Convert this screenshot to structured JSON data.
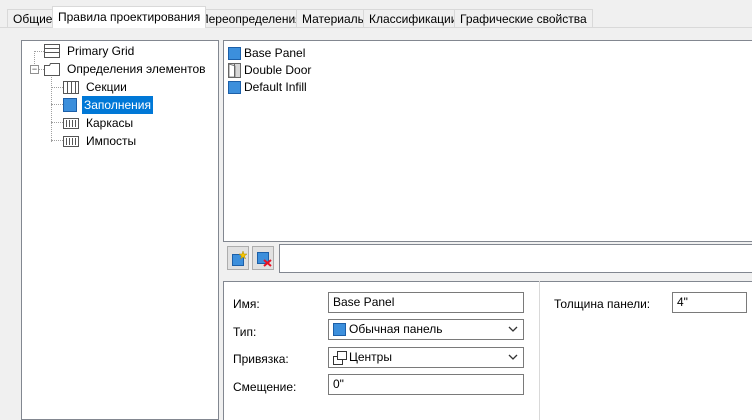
{
  "tabs": [
    {
      "label": "Общие",
      "active": false
    },
    {
      "label": "Правила проектирования",
      "active": true
    },
    {
      "label": "Переопределения",
      "active": false
    },
    {
      "label": "Материалы",
      "active": false
    },
    {
      "label": "Классификации",
      "active": false
    },
    {
      "label": "Графические свойства",
      "active": false
    }
  ],
  "tree": {
    "primary_grid": "Primary Grid",
    "element_definitions": "Определения элементов",
    "children": [
      "Секции",
      "Заполнения",
      "Каркасы",
      "Импосты"
    ],
    "selected": "Заполнения"
  },
  "list": {
    "items": [
      {
        "label": "Base Panel",
        "icon": "panel-icon"
      },
      {
        "label": "Double Door",
        "icon": "door-icon"
      },
      {
        "label": "Default Infill",
        "icon": "panel-icon"
      }
    ]
  },
  "toolbar": {
    "new_button": "new-infill-icon",
    "delete_button": "delete-infill-icon"
  },
  "props": {
    "name_label": "Имя:",
    "name_value": "Base Panel",
    "type_label": "Тип:",
    "type_value": "Обычная панель",
    "binding_label": "Привязка:",
    "binding_value": "Центры",
    "offset_label": "Смещение:",
    "offset_value": "0\"",
    "thickness_label": "Толщина панели:",
    "thickness_value": "4\""
  },
  "colors": {
    "selection": "#0078d7",
    "panel_blue": "#3c8fdc"
  }
}
